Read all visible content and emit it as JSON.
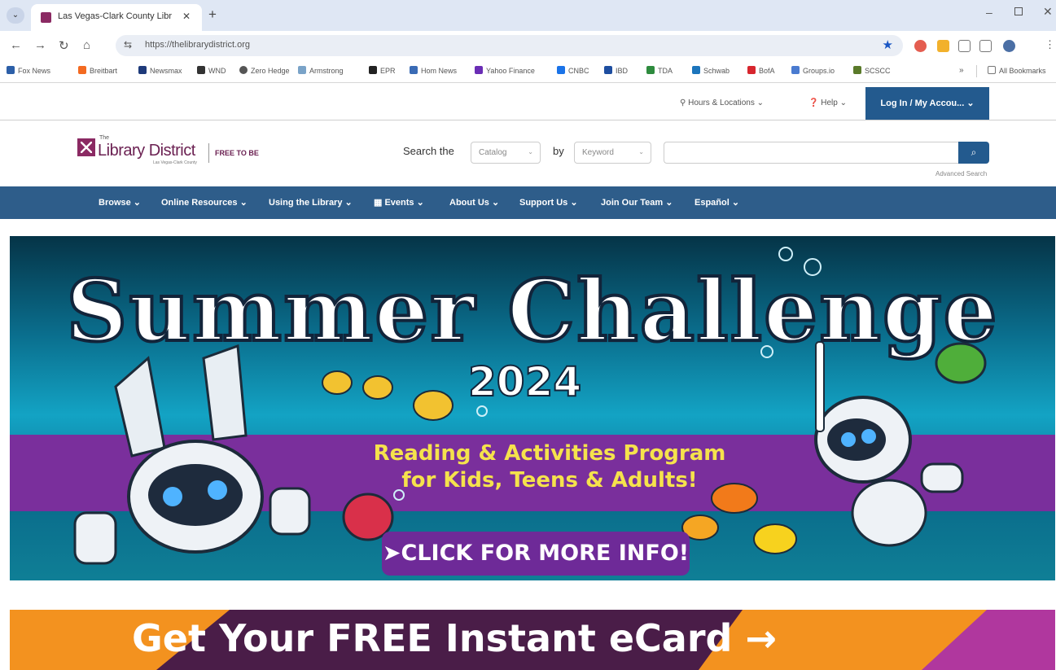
{
  "browser": {
    "tab_title": "Las Vegas-Clark County Library",
    "url": "https://thelibrarydistrict.org",
    "bookmarks": [
      "Fox News",
      "Breitbart",
      "Newsmax",
      "WND",
      "Zero Hedge",
      "Armstrong",
      "EPR",
      "Hom News",
      "Yahoo Finance",
      "CNBC",
      "IBD",
      "TDA",
      "Schwab",
      "BofA",
      "Groups.io",
      "SCSCC"
    ],
    "bookmarks_more": "»",
    "all_bookmarks": "All Bookmarks"
  },
  "utility": {
    "hours": "Hours & Locations",
    "help": "Help",
    "login": "Log In / My Accou..."
  },
  "logo": {
    "the": "The",
    "name": "Library District",
    "sub": "Las Vegas-Clark County",
    "tagline": "FREE TO BE"
  },
  "search": {
    "label_before": "Search the",
    "scope": "Catalog",
    "label_mid": "by",
    "field": "Keyword",
    "button_icon": "search-icon",
    "advanced": "Advanced Search"
  },
  "nav": {
    "items": [
      "Browse",
      "Online Resources",
      "Using the Library",
      "Events",
      "About Us",
      "Support Us",
      "Join Our Team",
      "Español"
    ]
  },
  "hero": {
    "title": "Summer Challenge",
    "year": "2024",
    "subtitle_line1": "Reading & Activities Program",
    "subtitle_line2": "for Kids, Teens & Adults!",
    "cta": "CLICK FOR MORE INFO!"
  },
  "ecard": {
    "text": "Get Your FREE Instant eCard →"
  },
  "colors": {
    "brand_blue": "#2e5d8a",
    "brand_plum": "#6b2152",
    "hero_purple": "#7a2f9c",
    "ecard_orange": "#f3921f"
  }
}
